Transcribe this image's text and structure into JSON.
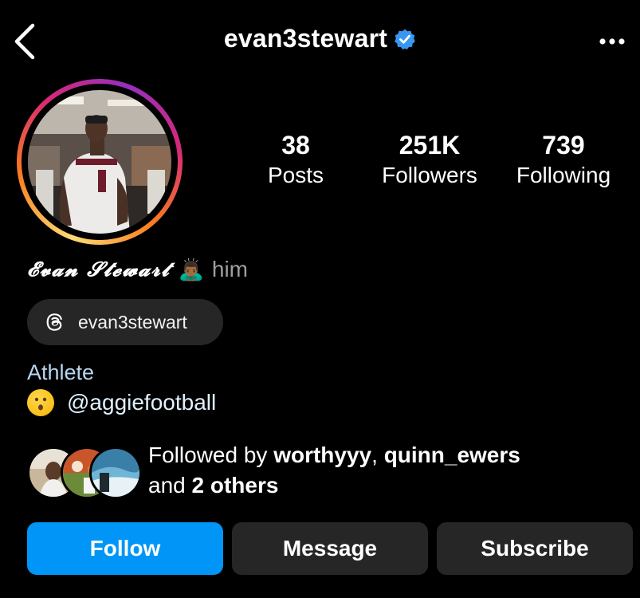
{
  "header": {
    "username": "evan3stewart",
    "back_icon": "chevron-left-icon",
    "verified_icon": "verified-badge-icon",
    "more_icon": "more-horizontal-icon"
  },
  "stats": {
    "posts": {
      "value": "38",
      "label": "Posts"
    },
    "followers": {
      "value": "251K",
      "label": "Followers"
    },
    "following": {
      "value": "739",
      "label": "Following"
    }
  },
  "profile": {
    "display_name": "𝓔𝓿𝓪𝓷 𝓢𝓽𝓮𝔀𝓪𝓻𝓽",
    "name_emoji": "🙇🏾‍♂️",
    "pronouns": "him",
    "threads_handle": "evan3stewart",
    "threads_icon": "threads-icon",
    "category": "Athlete",
    "bio_emoji": "hushed-face-emoji",
    "bio_mention": "@aggiefootball"
  },
  "followed_by": {
    "prefix": "Followed by ",
    "user1": "worthyyy",
    "separator": ", ",
    "user2": "quinn_ewers",
    "line2_prefix": "and ",
    "others": "2 others"
  },
  "actions": {
    "follow": "Follow",
    "message": "Message",
    "subscribe": "Subscribe"
  },
  "colors": {
    "background": "#000000",
    "follow_button": "#0095f6",
    "secondary_button": "#262626",
    "verified": "#3897f0"
  }
}
